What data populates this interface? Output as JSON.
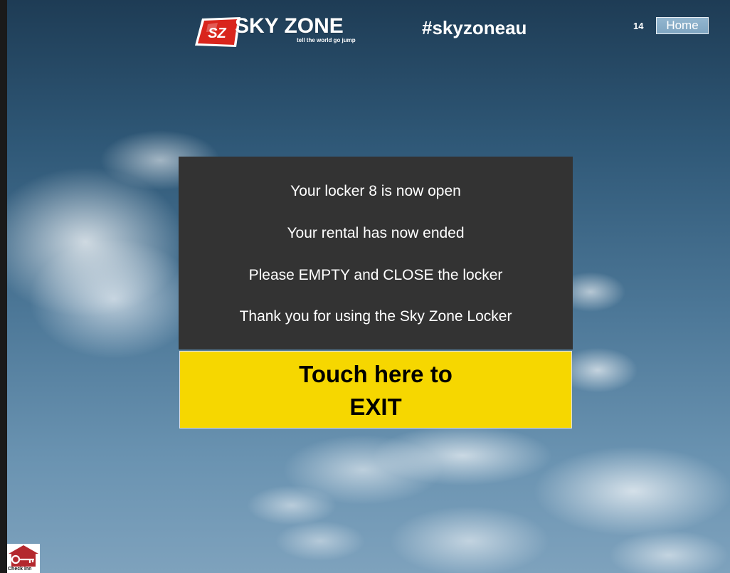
{
  "header": {
    "logo": {
      "brand_name": "SKY ZONE",
      "tagline": "tell the world go jump",
      "badge_text": "SZ"
    },
    "hashtag": "#skyzoneau",
    "counter": "14",
    "home_label": "Home"
  },
  "message_panel": {
    "line1": "Your locker 8 is now open",
    "line2": "Your rental has now ended",
    "line3": "Please EMPTY and CLOSE the locker",
    "line4": "Thank you for using the Sky Zone Locker"
  },
  "exit_button": {
    "line1": "Touch here to",
    "line2": "EXIT"
  },
  "check_inn": {
    "label": "Check Inn",
    "icon": "key-house-icon"
  },
  "colors": {
    "panel_background": "#333333",
    "exit_button_background": "#f6d700",
    "brand_red": "#d9251c",
    "home_button": "#86abc6"
  }
}
